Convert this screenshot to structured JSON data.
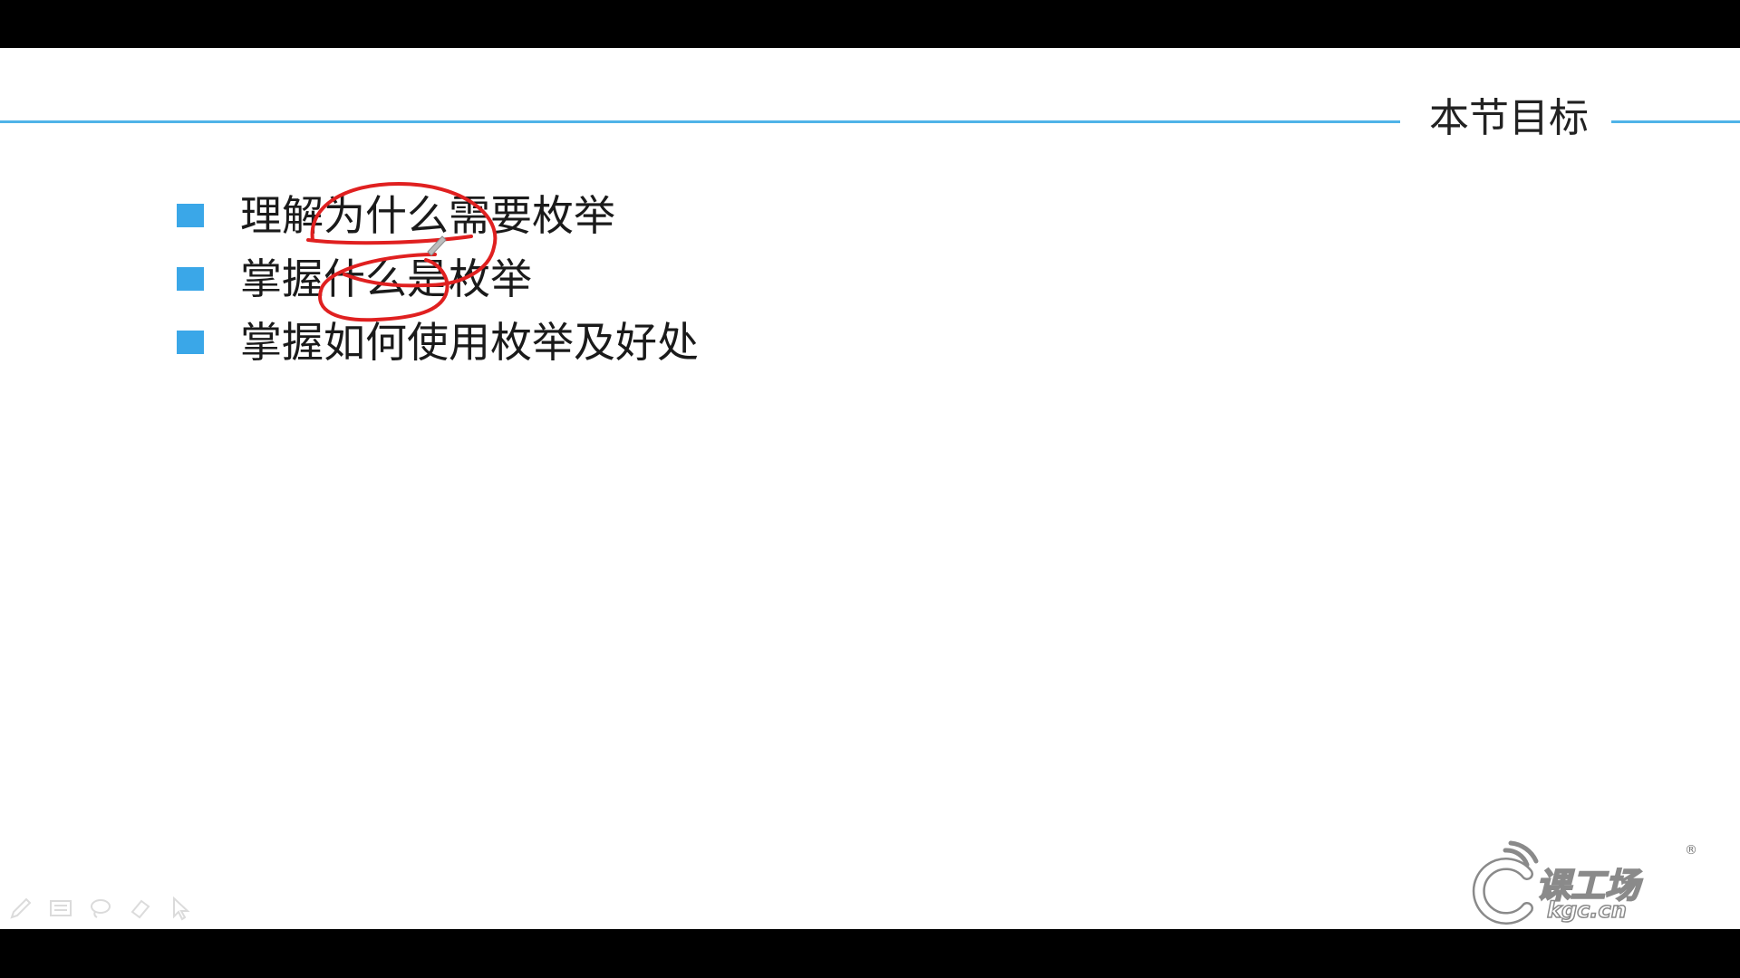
{
  "slide": {
    "section_title": "本节目标",
    "bullets": [
      {
        "text": "理解为什么需要枚举"
      },
      {
        "text": "掌握什么是枚举"
      },
      {
        "text": "掌握如何使用枚举及好处"
      }
    ]
  },
  "toolbar": {
    "tools": [
      {
        "icon": "pen-icon"
      },
      {
        "icon": "whiteboard-icon"
      },
      {
        "icon": "lasso-icon"
      },
      {
        "icon": "eraser-icon"
      },
      {
        "icon": "pointer-icon"
      }
    ]
  },
  "logo": {
    "name": "课工场",
    "domain": "kgc.cn",
    "registered_mark": "®"
  },
  "colors": {
    "accent": "#4fb3e8",
    "bullet": "#3aa7e8",
    "annotation": "#e02020"
  }
}
